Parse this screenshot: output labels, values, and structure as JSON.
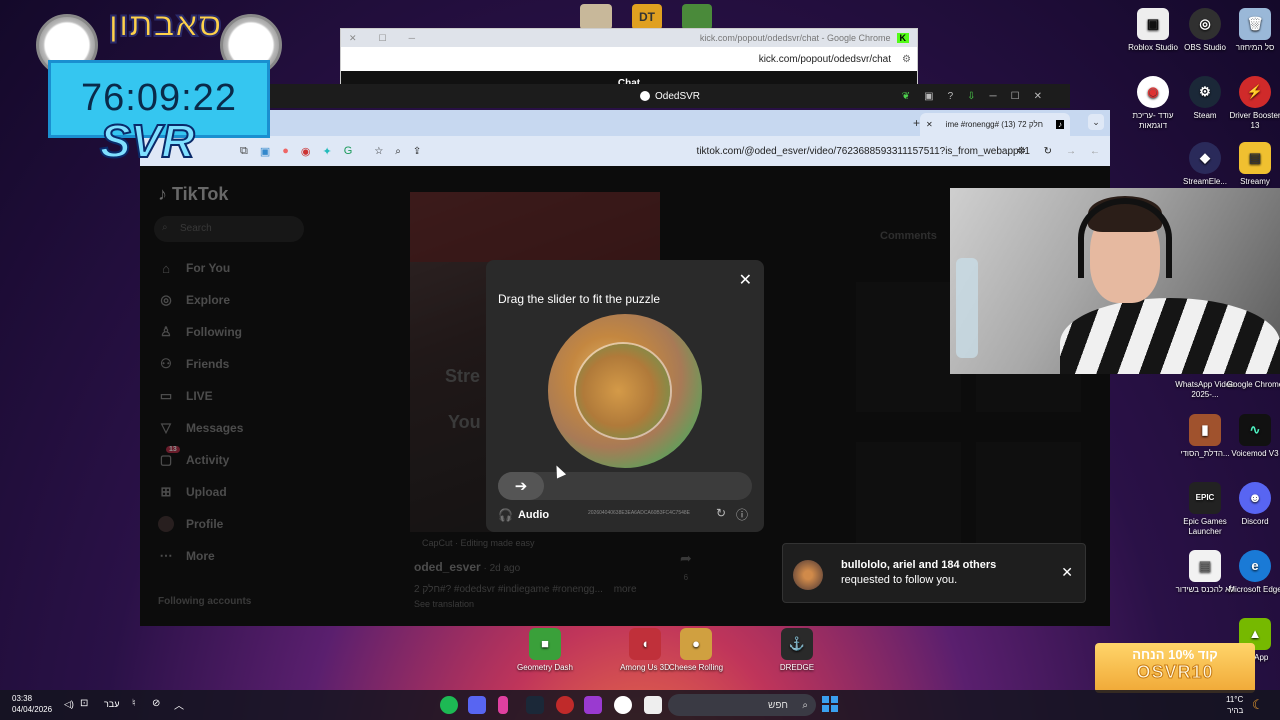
{
  "clock_overlay": {
    "title": "סאבתון",
    "timer": "76:09:22",
    "tag": "SVR"
  },
  "kick_window": {
    "title": "kick.com/popout/odedsvr/chat - Google Chrome",
    "url": "kick.com/popout/odedsvr/chat",
    "chat_label": "Chat"
  },
  "obs": {
    "title": "OdedSVR"
  },
  "chrome": {
    "tab_title": "ime #ronengg# חלק 72 (13)",
    "url": "tiktok.com/@oded_esver/video/7623688593311157511?is_from_webapp=1"
  },
  "tiktok": {
    "logo": "TikTok",
    "search_placeholder": "Search",
    "nav": [
      {
        "label": "For You",
        "icon": "home-icon"
      },
      {
        "label": "Explore",
        "icon": "compass-icon"
      },
      {
        "label": "Following",
        "icon": "following-icon"
      },
      {
        "label": "Friends",
        "icon": "friends-icon"
      },
      {
        "label": "LIVE",
        "icon": "live-icon"
      },
      {
        "label": "Messages",
        "icon": "messages-icon"
      },
      {
        "label": "Activity",
        "icon": "activity-icon",
        "badge": "13"
      },
      {
        "label": "Upload",
        "icon": "upload-icon"
      },
      {
        "label": "Profile",
        "icon": "profile-icon"
      },
      {
        "label": "More",
        "icon": "more-icon"
      }
    ],
    "following_accounts": "Following accounts",
    "video_text_1": "Stre",
    "video_text_2": "You",
    "comments": "Comments",
    "capcut": "CapCut · Editing made easy",
    "author": "oded_esver",
    "time_ago": "· 2d ago",
    "caption": "2 חלק#? #odedsvr #indiegame #ronengg...",
    "more": "more",
    "see_translation": "See translation",
    "share_count": "6"
  },
  "captcha": {
    "title": "Drag the slider to fit the puzzle",
    "audio_label": "Audio",
    "captcha_id": "202604040638E3EA6ADCA60B3FC4C7548E",
    "slider_progress": 0
  },
  "notification": {
    "names": "bullololo, ariel and 184 others",
    "message": "requested to follow you."
  },
  "desktop_icons": [
    {
      "label": "Roblox Studio",
      "color": "#eeeeee"
    },
    {
      "label": "OBS Studio",
      "color": "#303030"
    },
    {
      "label": "סל המיחזור",
      "color": "#9ab8d8"
    },
    {
      "label": "עודד -עריכת דוגמאות",
      "color": "#ffffff"
    },
    {
      "label": "Steam",
      "color": "#1b2838"
    },
    {
      "label": "Driver Booster 13",
      "color": "#d02a2a"
    },
    {
      "label": "StreamEle...",
      "color": "#2a2a5a"
    },
    {
      "label": "Streamy",
      "color": "#f0c030"
    },
    {
      "label": "WhatsApp Video 2025-...",
      "color": "#3a3a3a"
    },
    {
      "label": "Google Chrome",
      "color": "#ffffff"
    },
    {
      "label": "הדלת_הסודי...",
      "color": "#a0522d"
    },
    {
      "label": "Voicemod V3",
      "color": "#111111"
    },
    {
      "label": "Epic Games Launcher",
      "color": "#222222"
    },
    {
      "label": "Discord",
      "color": "#5865f2"
    },
    {
      "label": "לא להכנס בשידור",
      "color": "#f2f2f2"
    },
    {
      "label": "Microsoft Edge",
      "color": "#1a7ad6"
    },
    {
      "label": "NA App",
      "color": "#76b900"
    },
    {
      "label": "Geometry Dash",
      "color": "#3aa03a"
    },
    {
      "label": "Among Us 3D",
      "color": "#c0303a"
    },
    {
      "label": "Cheese Rolling",
      "color": "#d0a040"
    },
    {
      "label": "DREDGE",
      "color": "#2a2a2a"
    }
  ],
  "promo": {
    "text": "קוד 10% הנחה",
    "code": "OSVR10"
  },
  "taskbar": {
    "time": "03:38",
    "date": "04/04/2026",
    "language": "עבר",
    "search_placeholder": "חפש",
    "weather_temp": "11°C",
    "weather_desc": "בהיר"
  }
}
